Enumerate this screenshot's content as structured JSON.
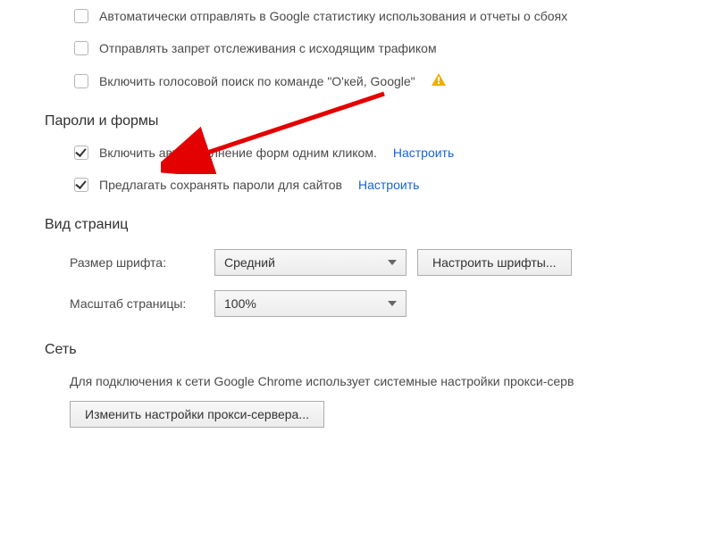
{
  "privacy": {
    "items": [
      {
        "label": "Автоматически отправлять в Google статистику использования и отчеты о сбоях",
        "checked": false
      },
      {
        "label": "Отправлять запрет отслеживания с исходящим трафиком",
        "checked": false
      },
      {
        "label": "Включить голосовой поиск по команде \"О'кей, Google\"",
        "checked": false,
        "warn": true
      }
    ]
  },
  "passwords": {
    "title": "Пароли и формы",
    "items": [
      {
        "label": "Включить автозаполнение форм одним кликом.",
        "checked": true,
        "link": "Настроить"
      },
      {
        "label": "Предлагать сохранять пароли для сайтов",
        "checked": true,
        "link": "Настроить"
      }
    ]
  },
  "appearance": {
    "title": "Вид страниц",
    "font_size_label": "Размер шрифта:",
    "font_size_value": "Средний",
    "customize_fonts": "Настроить шрифты...",
    "page_zoom_label": "Масштаб страницы:",
    "page_zoom_value": "100%"
  },
  "network": {
    "title": "Сеть",
    "description": "Для подключения к сети Google Chrome использует системные настройки прокси-серв",
    "proxy_button": "Изменить настройки прокси-сервера..."
  }
}
